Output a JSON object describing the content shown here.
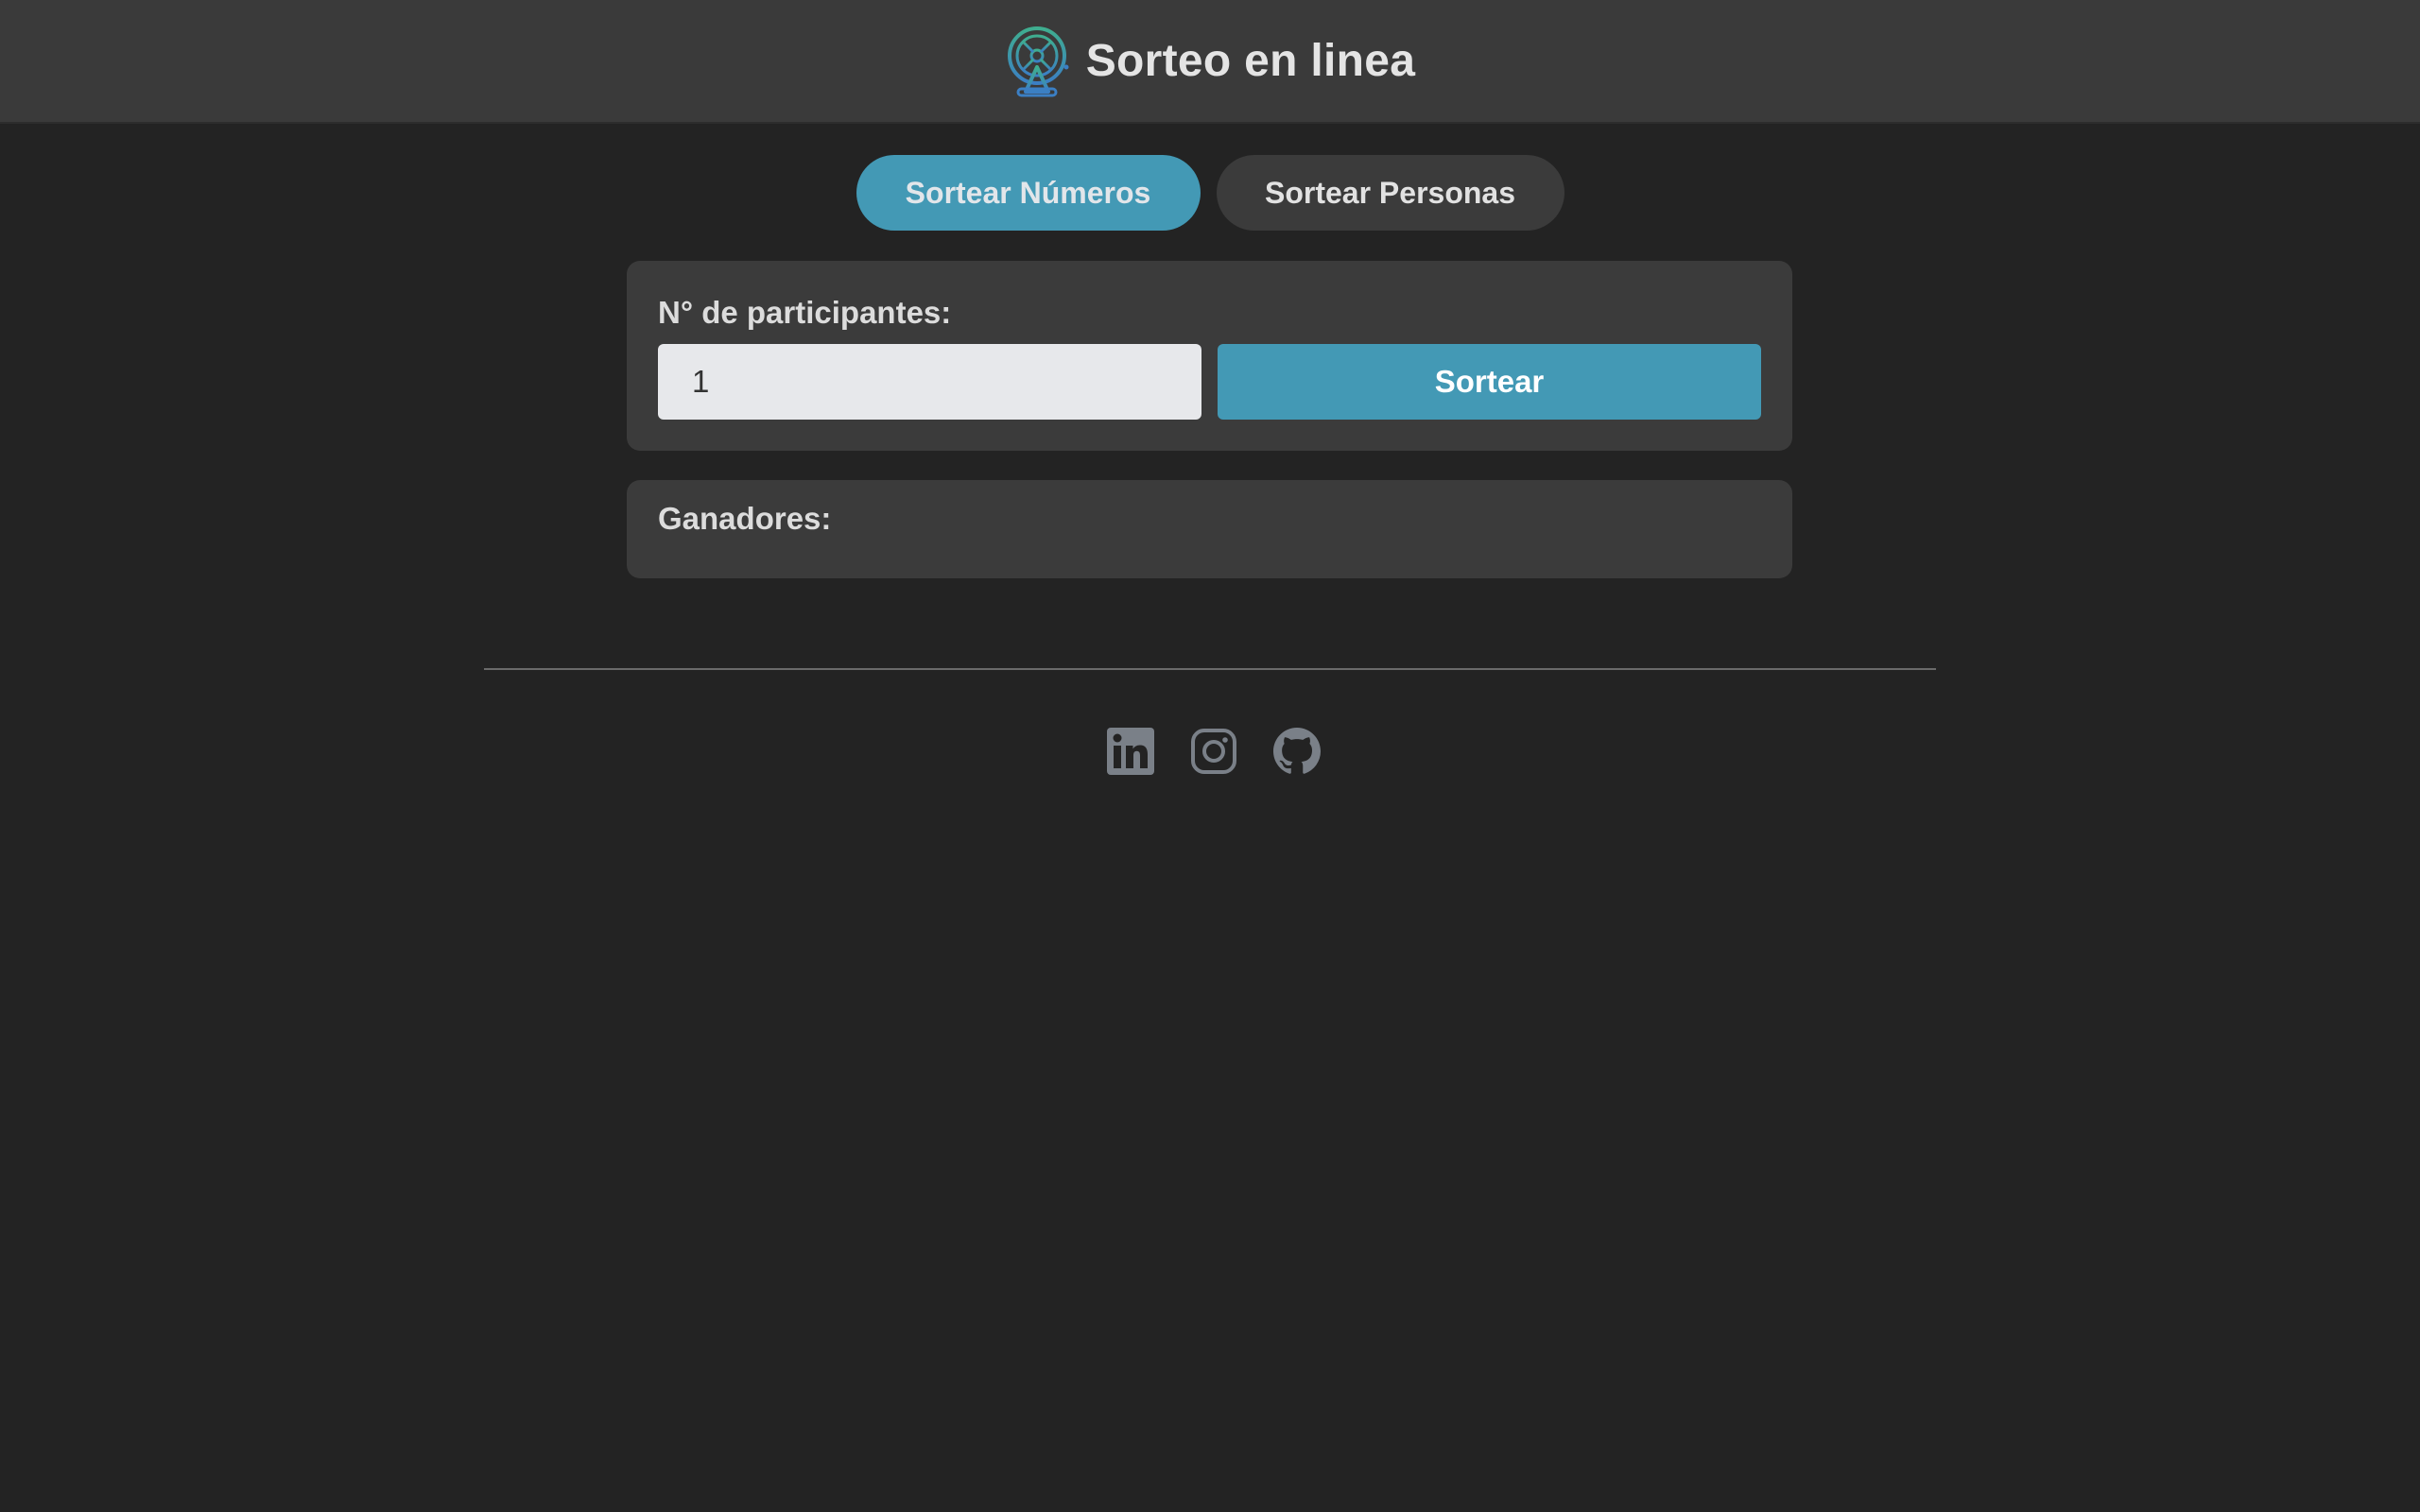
{
  "header": {
    "title": "Sorteo en linea",
    "logo_icon": "raffle-drum-icon"
  },
  "tabs": [
    {
      "label": "Sortear Números",
      "active": true
    },
    {
      "label": "Sortear Personas",
      "active": false
    }
  ],
  "form": {
    "label": "N° de participantes:",
    "participants_value": "1",
    "draw_label": "Sortear"
  },
  "winners": {
    "label": "Ganadores:"
  },
  "footer": {
    "social": [
      {
        "icon": "linkedin-icon"
      },
      {
        "icon": "instagram-icon"
      },
      {
        "icon": "github-icon"
      }
    ]
  },
  "colors": {
    "accent": "#4399b5",
    "background": "#232323",
    "surface": "#3b3b3b",
    "text": "#e4e4e4",
    "icon": "#7a8088"
  }
}
